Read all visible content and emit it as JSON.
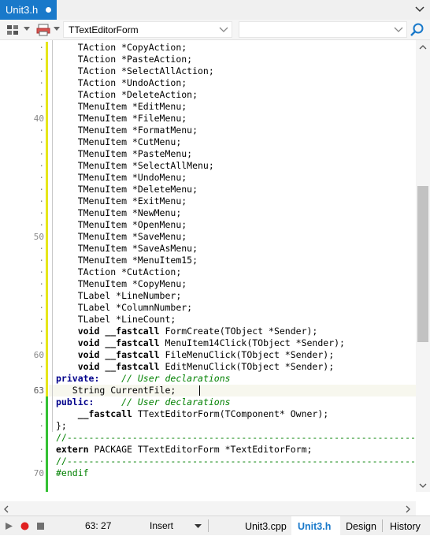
{
  "tab": {
    "title": "Unit3.h"
  },
  "toolbar": {
    "class_combo": "TTextEditorForm",
    "member_combo": ""
  },
  "editor": {
    "lines": [
      {
        "n": "·",
        "t": [
          [
            "    TAction *CopyAction;",
            ""
          ]
        ]
      },
      {
        "n": "·",
        "t": [
          [
            "    TAction *PasteAction;",
            ""
          ]
        ]
      },
      {
        "n": "·",
        "t": [
          [
            "    TAction *SelectAllAction;",
            ""
          ]
        ]
      },
      {
        "n": "·",
        "t": [
          [
            "    TAction *UndoAction;",
            ""
          ]
        ]
      },
      {
        "n": "·",
        "t": [
          [
            "    TAction *DeleteAction;",
            ""
          ]
        ]
      },
      {
        "n": "·",
        "t": [
          [
            "    TMenuItem *EditMenu;",
            ""
          ]
        ]
      },
      {
        "n": "40",
        "t": [
          [
            "    TMenuItem *FileMenu;",
            ""
          ]
        ]
      },
      {
        "n": "·",
        "t": [
          [
            "    TMenuItem *FormatMenu;",
            ""
          ]
        ]
      },
      {
        "n": "·",
        "t": [
          [
            "    TMenuItem *CutMenu;",
            ""
          ]
        ]
      },
      {
        "n": "·",
        "t": [
          [
            "    TMenuItem *PasteMenu;",
            ""
          ]
        ]
      },
      {
        "n": "·",
        "t": [
          [
            "    TMenuItem *SelectAllMenu;",
            ""
          ]
        ]
      },
      {
        "n": "·",
        "t": [
          [
            "    TMenuItem *UndoMenu;",
            ""
          ]
        ]
      },
      {
        "n": "·",
        "t": [
          [
            "    TMenuItem *DeleteMenu;",
            ""
          ]
        ]
      },
      {
        "n": "·",
        "t": [
          [
            "    TMenuItem *ExitMenu;",
            ""
          ]
        ]
      },
      {
        "n": "·",
        "t": [
          [
            "    TMenuItem *NewMenu;",
            ""
          ]
        ]
      },
      {
        "n": "·",
        "t": [
          [
            "    TMenuItem *OpenMenu;",
            ""
          ]
        ]
      },
      {
        "n": "50",
        "t": [
          [
            "    TMenuItem *SaveMenu;",
            ""
          ]
        ]
      },
      {
        "n": "·",
        "t": [
          [
            "    TMenuItem *SaveAsMenu;",
            ""
          ]
        ]
      },
      {
        "n": "·",
        "t": [
          [
            "    TMenuItem *MenuItem15;",
            ""
          ]
        ]
      },
      {
        "n": "·",
        "t": [
          [
            "    TAction *CutAction;",
            ""
          ]
        ]
      },
      {
        "n": "·",
        "t": [
          [
            "    TMenuItem *CopyMenu;",
            ""
          ]
        ]
      },
      {
        "n": "·",
        "t": [
          [
            "    TLabel *LineNumber;",
            ""
          ]
        ]
      },
      {
        "n": "·",
        "t": [
          [
            "    TLabel *ColumnNumber;",
            ""
          ]
        ]
      },
      {
        "n": "·",
        "t": [
          [
            "    TLabel *LineCount;",
            ""
          ]
        ]
      },
      {
        "n": "·",
        "t": [
          [
            "    ",
            ""
          ],
          [
            "void __fastcall",
            "kw"
          ],
          [
            " FormCreate(TObject *Sender);",
            ""
          ]
        ]
      },
      {
        "n": "·",
        "t": [
          [
            "    ",
            ""
          ],
          [
            "void __fastcall",
            "kw"
          ],
          [
            " MenuItem14Click(TObject *Sender);",
            ""
          ]
        ]
      },
      {
        "n": "60",
        "t": [
          [
            "    ",
            ""
          ],
          [
            "void __fastcall",
            "kw"
          ],
          [
            " FileMenuClick(TObject *Sender);",
            ""
          ]
        ]
      },
      {
        "n": "·",
        "t": [
          [
            "    ",
            ""
          ],
          [
            "void __fastcall",
            "kw"
          ],
          [
            " EditMenuClick(TObject *Sender);",
            ""
          ]
        ]
      },
      {
        "n": "·",
        "t": [
          [
            "private:",
            "kwb"
          ],
          [
            "    ",
            ""
          ],
          [
            "// User declarations",
            "cm"
          ]
        ]
      },
      {
        "n": "63",
        "t": [
          [
            "   String CurrentFile;",
            ""
          ]
        ]
      },
      {
        "n": "·",
        "t": [
          [
            "public:",
            "kwb"
          ],
          [
            "     ",
            ""
          ],
          [
            "// User declarations",
            "cm"
          ]
        ]
      },
      {
        "n": "·",
        "t": [
          [
            "    ",
            ""
          ],
          [
            "__fastcall",
            "kw"
          ],
          [
            " TTextEditorForm(TComponent* Owner);",
            ""
          ]
        ]
      },
      {
        "n": "·",
        "t": [
          [
            "};",
            ""
          ]
        ]
      },
      {
        "n": "·",
        "t": [
          [
            "//---------------------------------------------------------------------------",
            "cm2"
          ]
        ]
      },
      {
        "n": "·",
        "t": [
          [
            "extern",
            "kw"
          ],
          [
            " PACKAGE TTextEditorForm *TextEditorForm;",
            ""
          ]
        ]
      },
      {
        "n": "·",
        "t": [
          [
            "//---------------------------------------------------------------------------",
            "cm2"
          ]
        ]
      },
      {
        "n": "70",
        "t": [
          [
            "#endif",
            "cm2"
          ]
        ]
      }
    ]
  },
  "status": {
    "position": "63: 27",
    "mode": "Insert",
    "view_tabs": [
      "Unit3.cpp",
      "Unit3.h",
      "Design",
      "History"
    ],
    "active_tab": "Unit3.h"
  },
  "colors": {
    "accent": "#1979ca",
    "modified_bar": "#e6e61a",
    "saved_bar": "#34c134"
  }
}
